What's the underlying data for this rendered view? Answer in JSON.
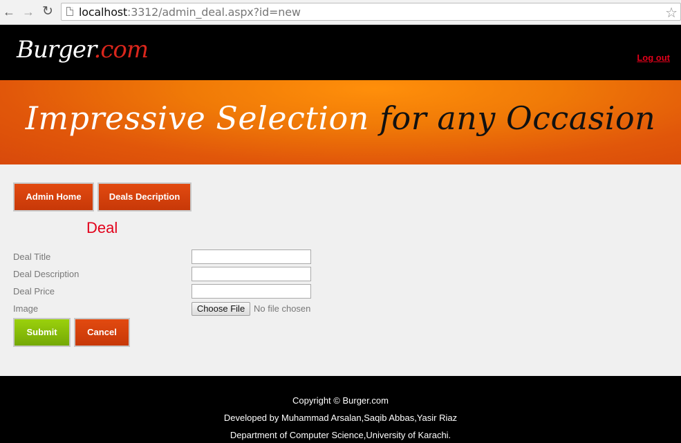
{
  "browser": {
    "url_host": "localhost",
    "url_rest": ":3312/admin_deal.aspx?id=new"
  },
  "header": {
    "logo_main": "Burger",
    "logo_accent": ".com",
    "logout": "Log out"
  },
  "banner": {
    "part1": "Impressive Selection",
    "part2": "for any Occasion"
  },
  "nav": {
    "admin_home": "Admin Home",
    "deals_description": "Deals Decription"
  },
  "form": {
    "heading": "Deal",
    "fields": [
      {
        "label": "Deal Title",
        "value": ""
      },
      {
        "label": "Deal Description",
        "value": ""
      },
      {
        "label": "Deal Price",
        "value": ""
      },
      {
        "label": "Image"
      }
    ],
    "choose_file": "Choose File",
    "file_status": "No file chosen",
    "submit": "Submit",
    "cancel": "Cancel"
  },
  "footer": {
    "line1": "Copyright © Burger.com",
    "line2": "Developed by Muhammad Arsalan,Saqib Abbas,Yasir Riaz",
    "line3": "Department of Computer Science,University of Karachi."
  },
  "colors": {
    "accent_red": "#e2001a",
    "button_red": "#d23f0b",
    "button_green": "#8bc10a",
    "banner_orange": "#f07a07"
  }
}
